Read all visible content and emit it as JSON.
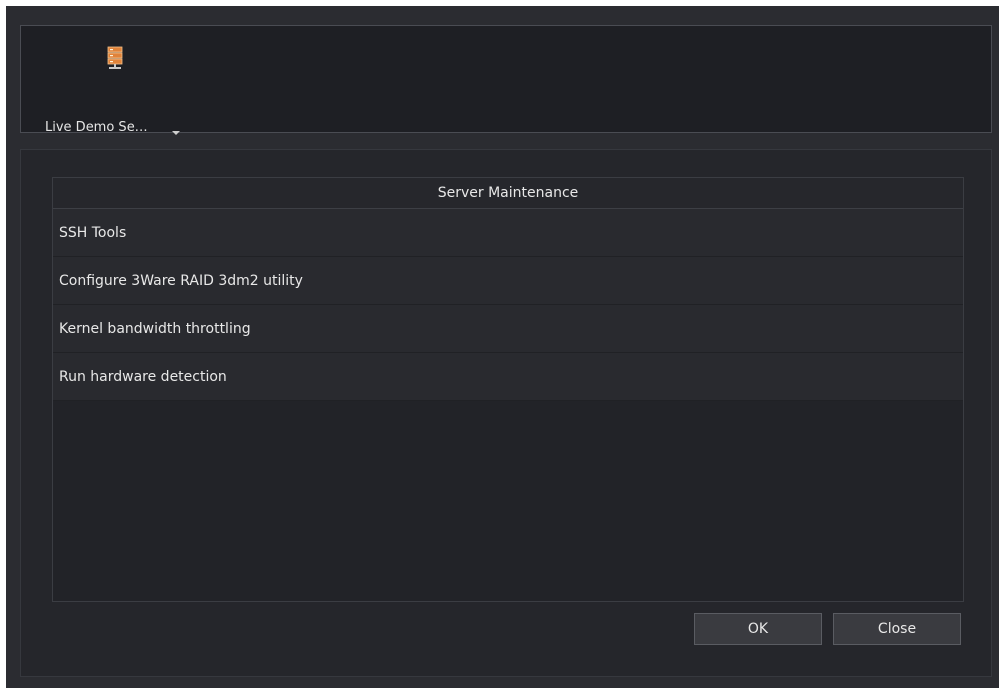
{
  "toolbar": {
    "server_label": "Live Demo Se…",
    "server_icon": "server-icon"
  },
  "list": {
    "header": "Server Maintenance",
    "items": [
      {
        "label": "SSH Tools"
      },
      {
        "label": "Configure 3Ware RAID 3dm2 utility"
      },
      {
        "label": "Kernel bandwidth throttling"
      },
      {
        "label": "Run hardware detection"
      }
    ]
  },
  "buttons": {
    "ok": "OK",
    "close": "Close"
  },
  "colors": {
    "background": "#2b2c31",
    "toolbar": "#1e1f24",
    "icon_accent": "#e0833a"
  }
}
